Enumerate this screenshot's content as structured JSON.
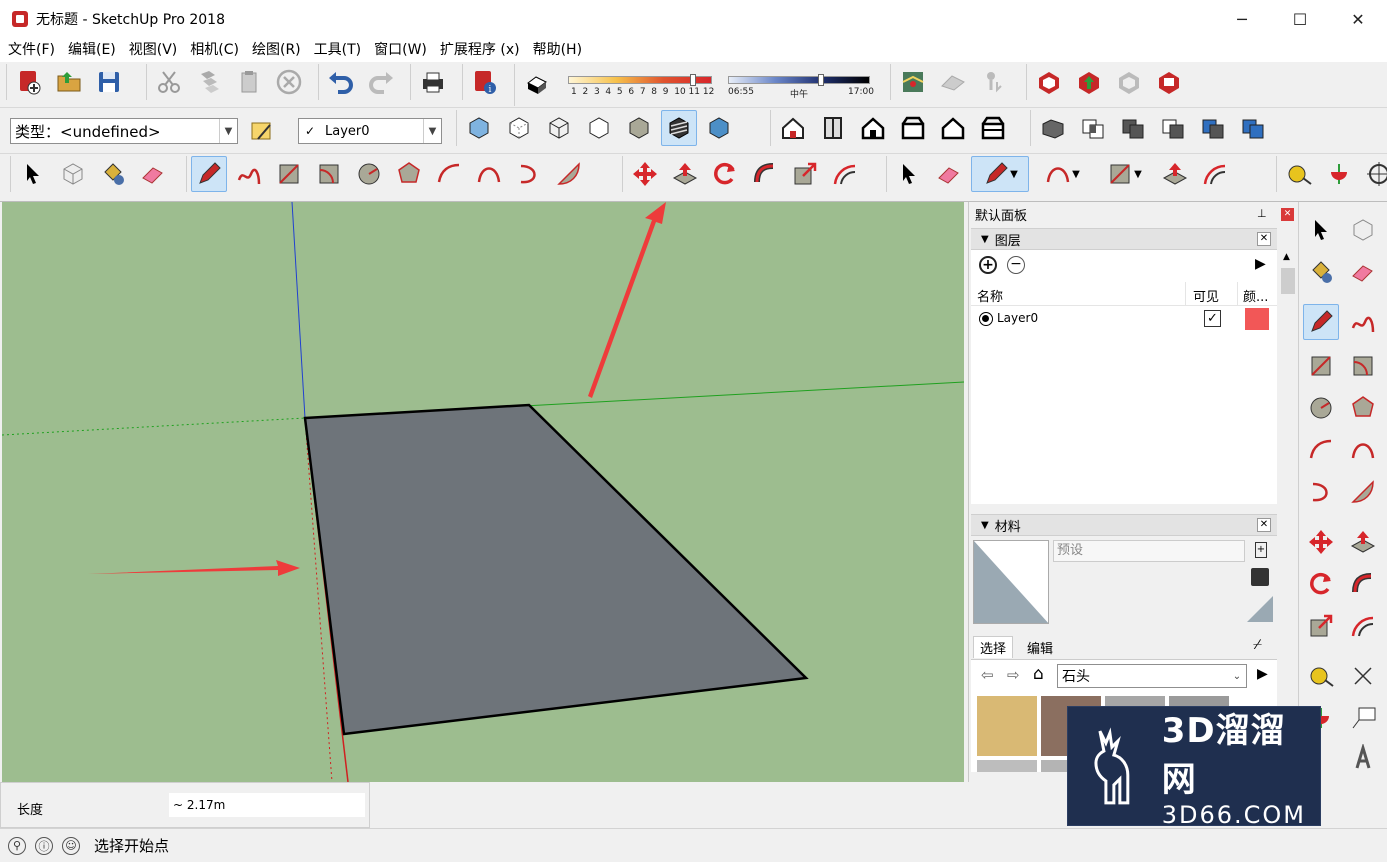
{
  "window": {
    "title": "无标题 - SketchUp Pro 2018",
    "minimize": "─",
    "maximize": "☐",
    "close": "✕"
  },
  "menu": [
    "文件(F)",
    "编辑(E)",
    "视图(V)",
    "相机(C)",
    "绘图(R)",
    "工具(T)",
    "窗口(W)",
    "扩展程序 (x)",
    "帮助(H)"
  ],
  "shadow_bar": {
    "months": [
      "1",
      "2",
      "3",
      "4",
      "5",
      "6",
      "7",
      "8",
      "9",
      "10",
      "11",
      "12"
    ],
    "time_start": "06:55",
    "time_mid": "中午",
    "time_end": "17:00"
  },
  "style_combo": {
    "value": "类型：<undefined>"
  },
  "layer_combo": {
    "check": "✓",
    "value": "Layer0"
  },
  "tray": {
    "title": "默认面板",
    "pin": "⊥",
    "close": "✕",
    "layers": {
      "title": "图层",
      "col_name": "名称",
      "col_visible": "可见",
      "col_color": "颜...",
      "rows": [
        {
          "name": "Layer0",
          "visible": true,
          "color": "#f25757"
        }
      ]
    },
    "materials": {
      "title": "材料",
      "name_placeholder": "预设",
      "tab_select": "选择",
      "tab_edit": "编辑",
      "collection": "石头",
      "swatch_colors": [
        "#d9b974",
        "#8b6f60",
        "#a6a6a6",
        "#9a9a9a",
        "#bdbdbd",
        "#b4b4b4"
      ]
    }
  },
  "measurements": {
    "label": "长度",
    "value": "~ 2.17m"
  },
  "status": {
    "message": "选择开始点"
  },
  "watermark": {
    "line1": "3D溜溜网",
    "line2": "3D66.COM"
  },
  "colors": {
    "viewport_bg": "#9dbd8f",
    "face": "#6e747a",
    "arrow": "#ee3b3b",
    "accent_red": "#c62828"
  }
}
